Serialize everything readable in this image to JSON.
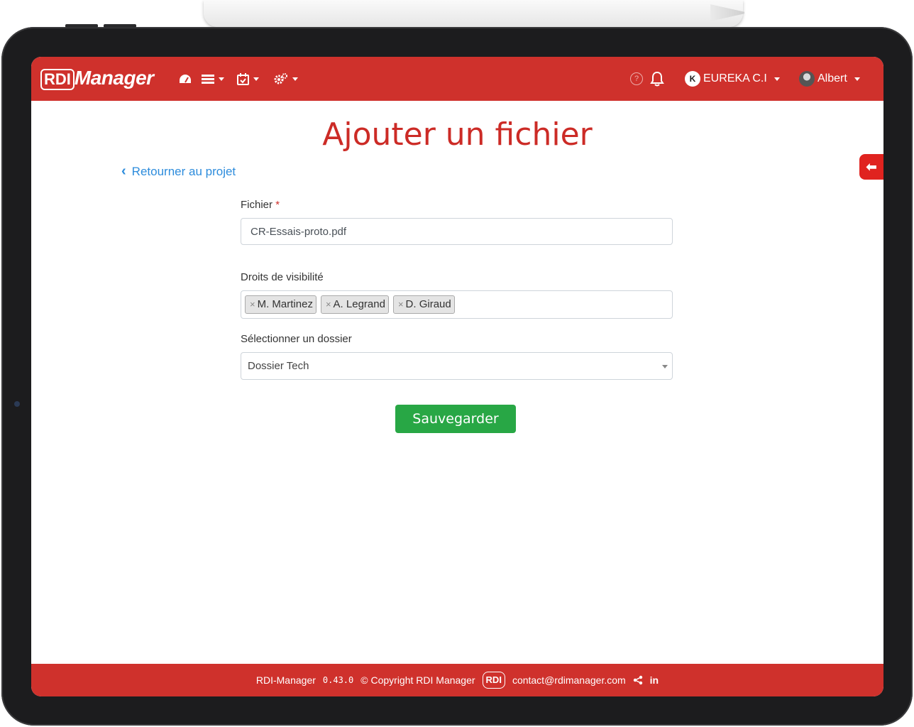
{
  "navbar": {
    "brand_rdi": "RDI",
    "brand_manager": "Manager",
    "icons": [
      "dashboard-icon",
      "projects-icon",
      "calendar-icon",
      "settings-icon"
    ],
    "help_symbol": "?",
    "organization": "EUREKA C.I",
    "user": "Albert",
    "colors": {
      "navbar_bg": "#cf312c",
      "text": "#ffffff"
    }
  },
  "page": {
    "title": "Ajouter un fichier",
    "back_link": "Retourner au projet"
  },
  "form": {
    "file_label": "Fichier",
    "required_mark": "*",
    "file_value": "CR-Essais-proto.pdf",
    "visibility_label": "Droits de visibilité",
    "visibility_tags": [
      "M. Martinez",
      "A. Legrand",
      "D. Giraud"
    ],
    "tag_remove": "×",
    "folder_label": "Sélectionner un dossier",
    "folder_value": "Dossier Tech",
    "save_button": "Sauvegarder"
  },
  "footer": {
    "app": "RDI-Manager",
    "version": "0.43.0",
    "copyright": "© Copyright RDI Manager",
    "logo": "RDI",
    "email": "contact@rdimanager.com",
    "linkedin": "in"
  },
  "colors": {
    "accent": "#cf312c",
    "save": "#28a745",
    "link": "#2d8cdc"
  }
}
